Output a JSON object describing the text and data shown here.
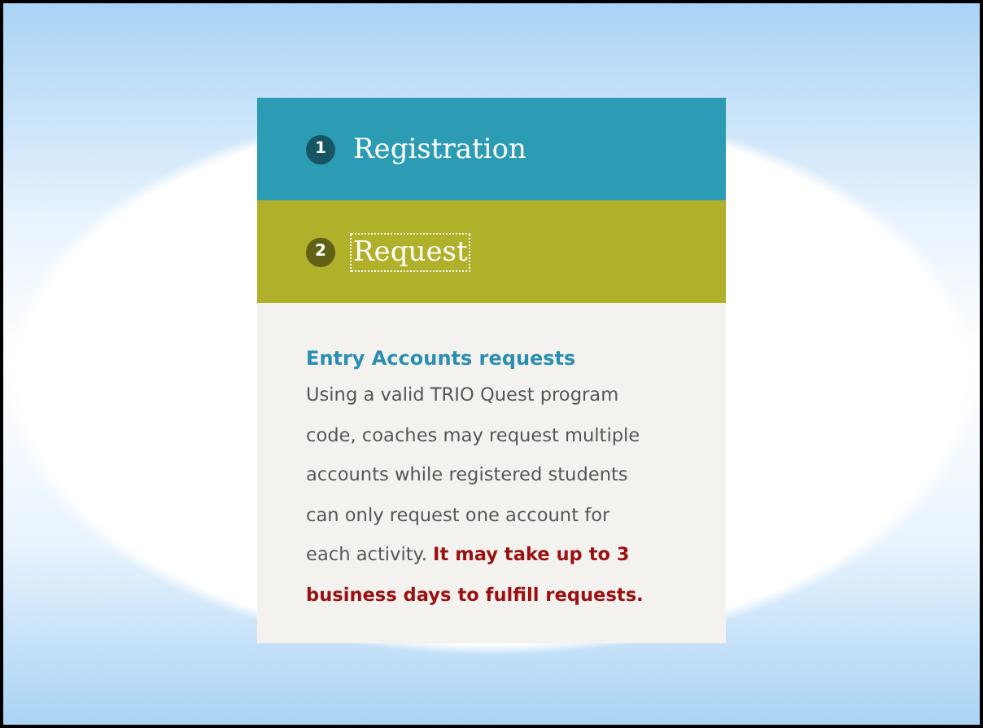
{
  "steps": [
    {
      "number": "1",
      "label": "Registration",
      "selected": false,
      "color": "#2b9cb4"
    },
    {
      "number": "2",
      "label": "Request",
      "selected": true,
      "color": "#b1b02b"
    }
  ],
  "panel": {
    "heading": "Entry Accounts requests",
    "text": "Using a valid TRIO Quest program code, coaches may request multiple accounts while registered students can only request one account for each activity. **It may take up to 3 business days to fulfill requests.**"
  }
}
